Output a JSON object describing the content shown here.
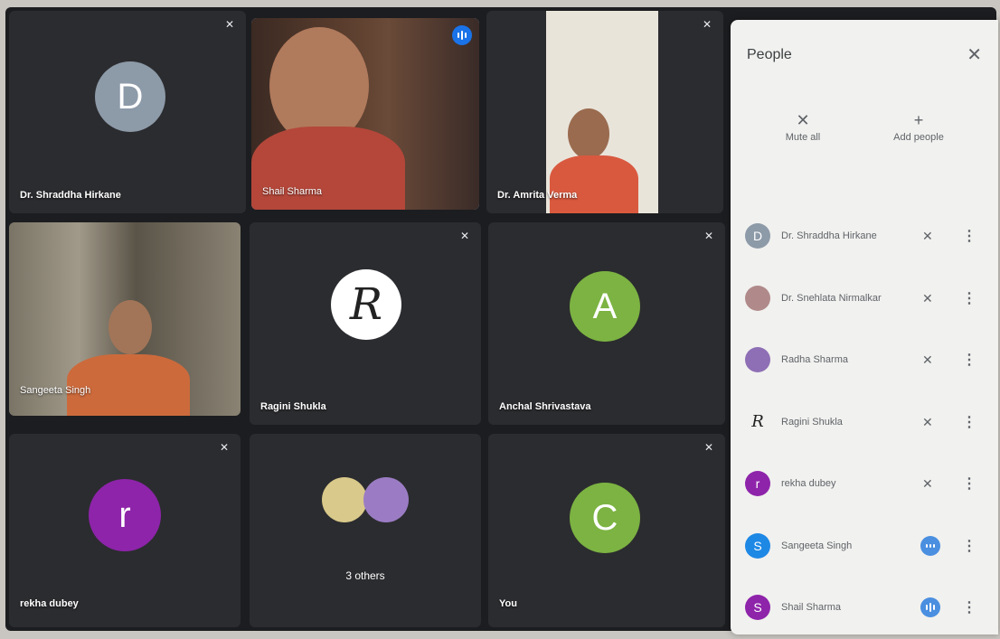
{
  "tiles": {
    "shraddha": {
      "name": "Dr. Shraddha Hirkane",
      "initial": "D",
      "color": "#8d9aa8"
    },
    "shail": {
      "name": "Shail Sharma"
    },
    "amrita": {
      "name": "Dr. Amrita Verma"
    },
    "sangeeta": {
      "name": "Sangeeta Singh"
    },
    "ragini": {
      "name": "Ragini Shukla",
      "logo": "R"
    },
    "anchal": {
      "name": "Anchal Shrivastava",
      "initial": "A",
      "color": "#7cb342"
    },
    "rekha": {
      "name": "rekha dubey",
      "initial": "r",
      "color": "#8e24aa"
    },
    "others": {
      "name": "3 others"
    },
    "you": {
      "name": "You",
      "initial": "C",
      "color": "#7cb342"
    }
  },
  "icons": {
    "mic_off": "mic-off-icon",
    "speaking": "speaking-icon",
    "close": "close-icon",
    "add_person": "add-person-icon",
    "more": "more-vert-icon"
  },
  "panel": {
    "title": "People",
    "mute_all": "Mute all",
    "add_people": "Add people",
    "people": [
      {
        "name": "Dr. Shraddha Hirkane",
        "initial": "D",
        "color": "#8d9aa8"
      },
      {
        "name": "Dr. Snehlata Nirmalkar",
        "initial": "",
        "color": "#b08a8a"
      },
      {
        "name": "Radha Sharma",
        "initial": "",
        "color": "#8e6fb5"
      },
      {
        "name": "Ragini Shukla",
        "initial": "R",
        "color": "#f1f1ef"
      },
      {
        "name": "rekha dubey",
        "initial": "r",
        "color": "#8e24aa"
      },
      {
        "name": "Sangeeta Singh",
        "initial": "S",
        "color": "#1e88e5"
      },
      {
        "name": "Shail Sharma",
        "initial": "S",
        "color": "#8e24aa"
      }
    ]
  },
  "accent": "#1a73e8"
}
